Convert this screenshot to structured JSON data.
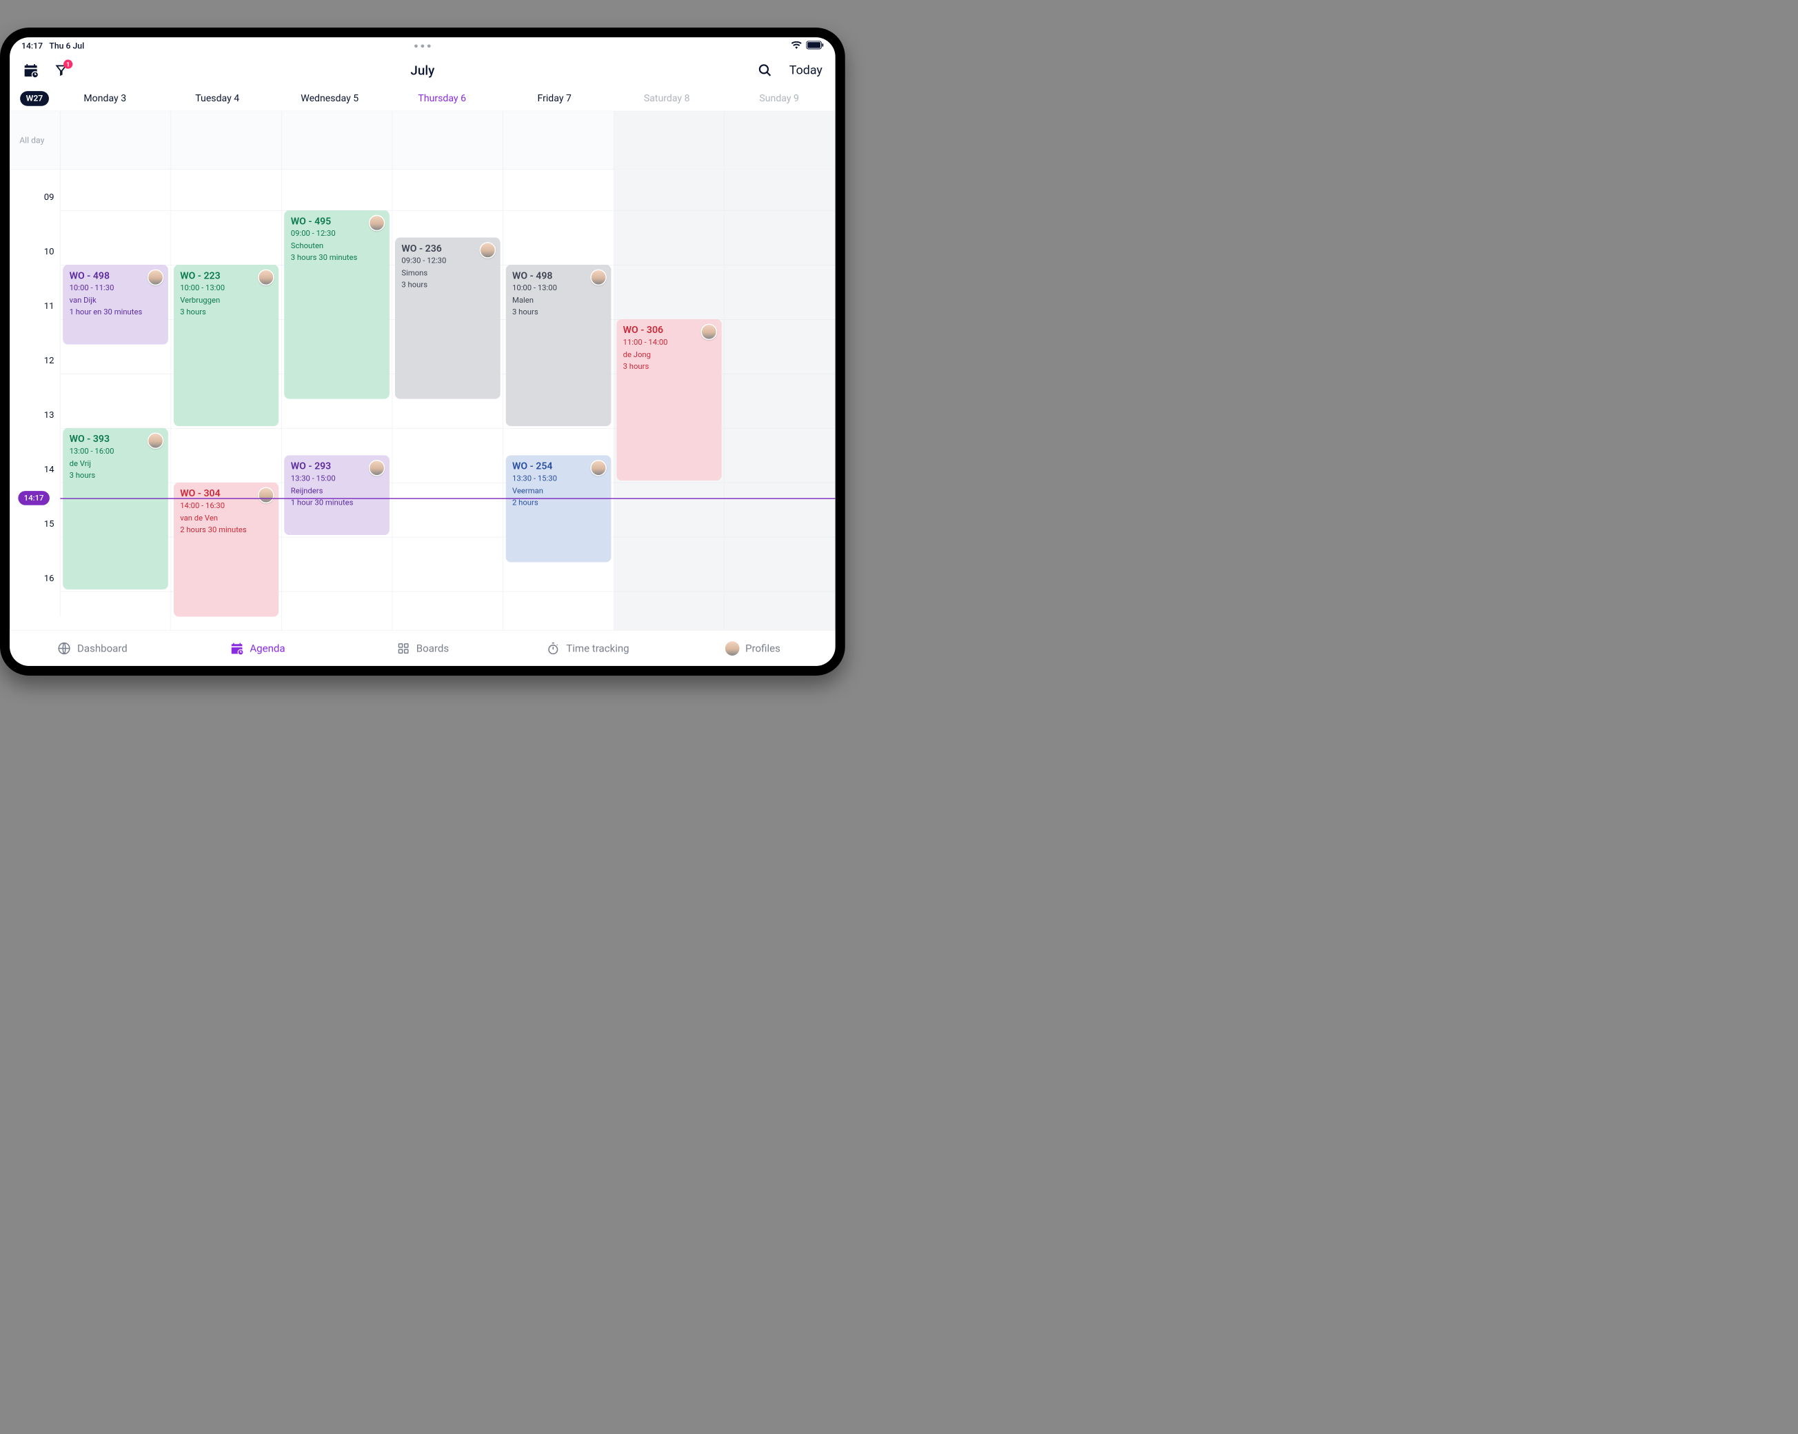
{
  "status": {
    "time": "14:17",
    "date": "Thu 6 Jul"
  },
  "header": {
    "title": "July",
    "notification_count": "1",
    "today_label": "Today"
  },
  "week_badge": "W27",
  "days": [
    {
      "label": "Monday 3",
      "today": false,
      "muted": false
    },
    {
      "label": "Tuesday 4",
      "today": false,
      "muted": false
    },
    {
      "label": "Wednesday 5",
      "today": false,
      "muted": false
    },
    {
      "label": "Thursday 6",
      "today": true,
      "muted": false
    },
    {
      "label": "Friday 7",
      "today": false,
      "muted": false
    },
    {
      "label": "Saturday 8",
      "today": false,
      "muted": true
    },
    {
      "label": "Sunday 9",
      "today": false,
      "muted": true
    }
  ],
  "allday_label": "All day",
  "hours": [
    "09",
    "10",
    "11",
    "12",
    "13",
    "14",
    "15",
    "16"
  ],
  "now": "14:17",
  "events": [
    {
      "day": 0,
      "color": "purple",
      "start": 10.0,
      "end": 11.5,
      "title": "WO - 498",
      "time": "10:00 - 11:30",
      "name": "van Dijk",
      "dur": "1 hour en 30 minutes"
    },
    {
      "day": 0,
      "color": "green",
      "start": 13.0,
      "end": 16.0,
      "title": "WO - 393",
      "time": "13:00 - 16:00",
      "name": "de Vrij",
      "dur": "3 hours"
    },
    {
      "day": 1,
      "color": "green",
      "start": 10.0,
      "end": 13.0,
      "title": "WO - 223",
      "time": "10:00 - 13:00",
      "name": "Verbruggen",
      "dur": "3 hours"
    },
    {
      "day": 1,
      "color": "pink",
      "start": 14.0,
      "end": 16.5,
      "title": "WO - 304",
      "time": "14:00 - 16:30",
      "name": "van de Ven",
      "dur": "2 hours 30 minutes"
    },
    {
      "day": 2,
      "color": "green",
      "start": 9.0,
      "end": 12.5,
      "title": "WO - 495",
      "time": "09:00 - 12:30",
      "name": "Schouten",
      "dur": "3 hours 30 minutes"
    },
    {
      "day": 2,
      "color": "purple",
      "start": 13.5,
      "end": 15.0,
      "title": "WO - 293",
      "time": "13:30 - 15:00",
      "name": "Reijnders",
      "dur": "1 hour 30 minutes"
    },
    {
      "day": 3,
      "color": "gray",
      "start": 9.5,
      "end": 12.5,
      "title": "WO - 236",
      "time": "09:30 - 12:30",
      "name": "Simons",
      "dur": "3 hours"
    },
    {
      "day": 4,
      "color": "gray",
      "start": 10.0,
      "end": 13.0,
      "title": "WO - 498",
      "time": "10:00 - 13:00",
      "name": "Malen",
      "dur": "3 hours"
    },
    {
      "day": 4,
      "color": "blue",
      "start": 13.5,
      "end": 15.5,
      "title": "WO - 254",
      "time": "13:30 - 15:30",
      "name": "Veerman",
      "dur": "2 hours"
    },
    {
      "day": 5,
      "color": "pink",
      "start": 11.0,
      "end": 14.0,
      "title": "WO - 306",
      "time": "11:00 - 14:00",
      "name": "de Jong",
      "dur": "3 hours"
    }
  ],
  "nav": {
    "dashboard": "Dashboard",
    "agenda": "Agenda",
    "boards": "Boards",
    "time_tracking": "Time tracking",
    "profiles": "Profiles"
  }
}
